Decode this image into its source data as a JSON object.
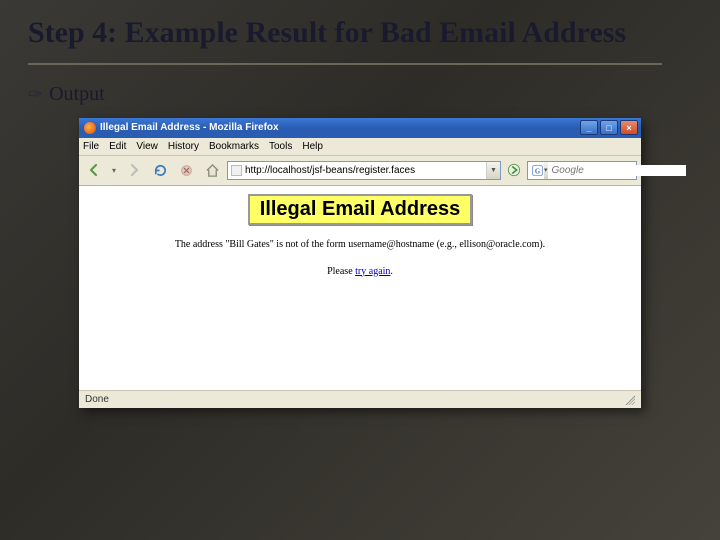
{
  "slide": {
    "title": "Step 4: Example Result for Bad Email Address",
    "bullet": "Output"
  },
  "window": {
    "title": "Illegal Email Address - Mozilla Firefox"
  },
  "menu": {
    "file": "File",
    "edit": "Edit",
    "view": "View",
    "history": "History",
    "bookmarks": "Bookmarks",
    "tools": "Tools",
    "help": "Help"
  },
  "toolbar": {
    "url": "http://localhost/jsf-beans/register.faces",
    "search_placeholder": "Google",
    "search_engine_letter": "G"
  },
  "page": {
    "heading": "Illegal Email Address",
    "message": "The address \"Bill Gates\" is not of the form username@hostname (e.g., ellison@oracle.com).",
    "retry_prefix": "Please ",
    "retry_link": "try again",
    "retry_suffix": "."
  },
  "status": {
    "text": "Done"
  }
}
